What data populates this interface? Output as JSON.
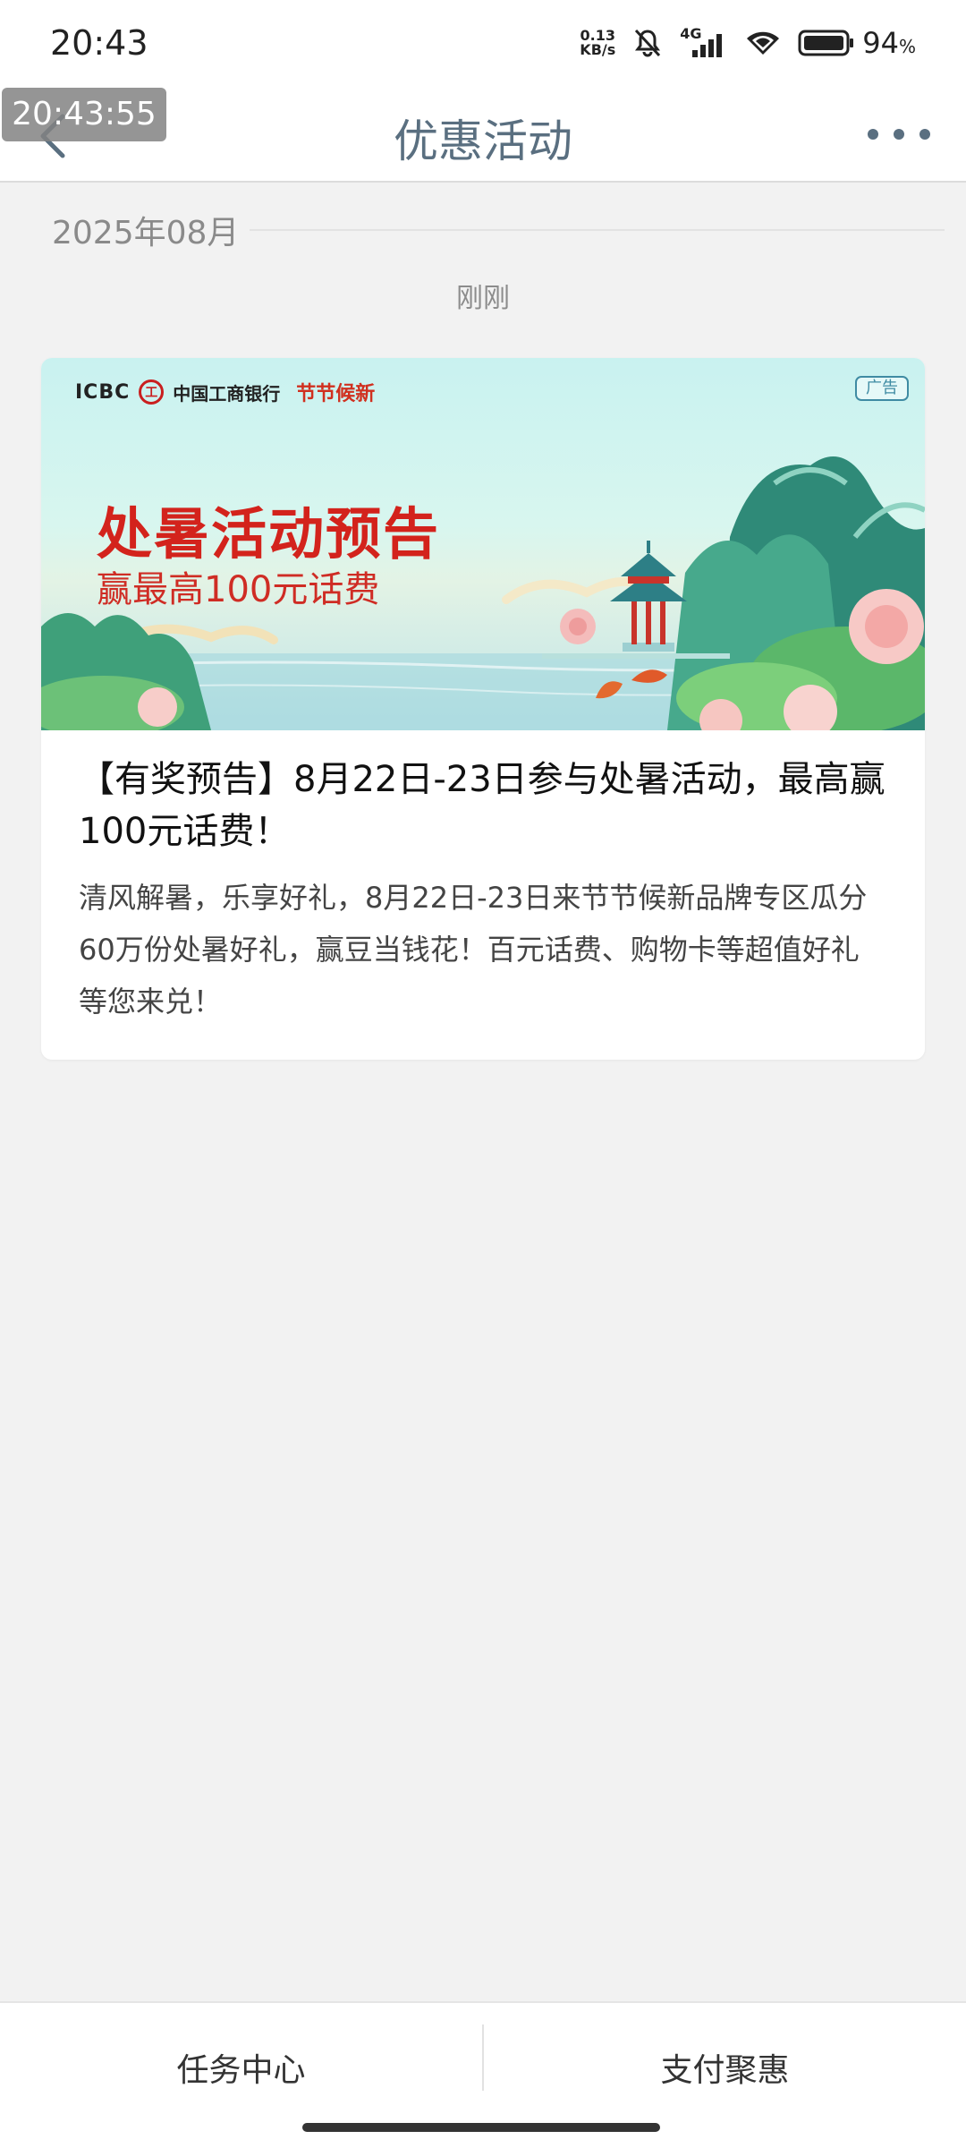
{
  "status_bar": {
    "time": "20:43",
    "net_speed_value": "0.13",
    "net_speed_unit": "KB/s",
    "signal_label": "4G",
    "battery_percent": "94",
    "battery_unit": "%"
  },
  "overlay": {
    "timestamp": "20:43:55"
  },
  "header": {
    "title": "优惠活动"
  },
  "feed": {
    "date_label": "2025年08月",
    "time_ago": "刚刚"
  },
  "card": {
    "banner": {
      "bank_short": "ICBC",
      "seal_text": "工",
      "bank_name": "中国工商银行",
      "brand": "节节候新",
      "ad_badge": "广告",
      "headline": "处暑活动预告",
      "subheadline": "赢最高100元话费"
    },
    "title": "【有奖预告】8月22日-23日参与处暑活动，最高赢100元话费！",
    "description": "清风解暑，乐享好礼，8月22日-23日来节节候新品牌专区瓜分60万份处暑好礼，赢豆当钱花！百元话费、购物卡等超值好礼等您来兑！"
  },
  "bottom_tabs": [
    {
      "label": "任务中心"
    },
    {
      "label": "支付聚惠"
    }
  ],
  "colors": {
    "header_title": "#5a6f80",
    "banner_red": "#d3231c",
    "page_bg": "#f2f2f2"
  }
}
